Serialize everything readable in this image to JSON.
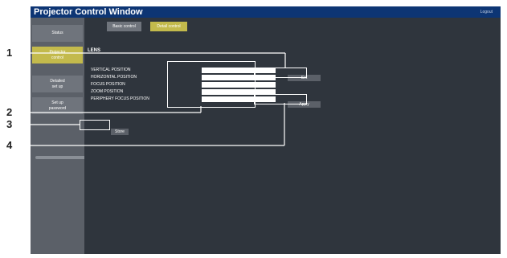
{
  "window": {
    "title": "Projector Control Window",
    "top_right_text": "Logout"
  },
  "sidebar": {
    "items": [
      {
        "label": "Status"
      },
      {
        "label": "Projector\ncontrol"
      },
      {
        "label": "Detailed\nset up"
      },
      {
        "label": "Set up\npassword"
      }
    ]
  },
  "tabs": {
    "basic": "Basic control",
    "detail": "Detail control"
  },
  "lens": {
    "section_title": "LENS",
    "fields": [
      {
        "label": "VERTICAL POSITION",
        "value": ""
      },
      {
        "label": "HORIZONTAL POSITION",
        "value": ""
      },
      {
        "label": "FOCUS POSITION",
        "value": ""
      },
      {
        "label": "ZOOM POSITION",
        "value": ""
      },
      {
        "label": "PERIPHERY FOCUS POSITION",
        "value": ""
      }
    ],
    "set_label": "Set",
    "apply_label": "Apply",
    "store_label": "Store"
  },
  "callouts": [
    "1",
    "2",
    "3",
    "4"
  ],
  "colors": {
    "title_bar": "#0d3574",
    "active_accent": "#c3ba4c",
    "panel": "#2f353d",
    "sidebar": "#5b6068"
  }
}
